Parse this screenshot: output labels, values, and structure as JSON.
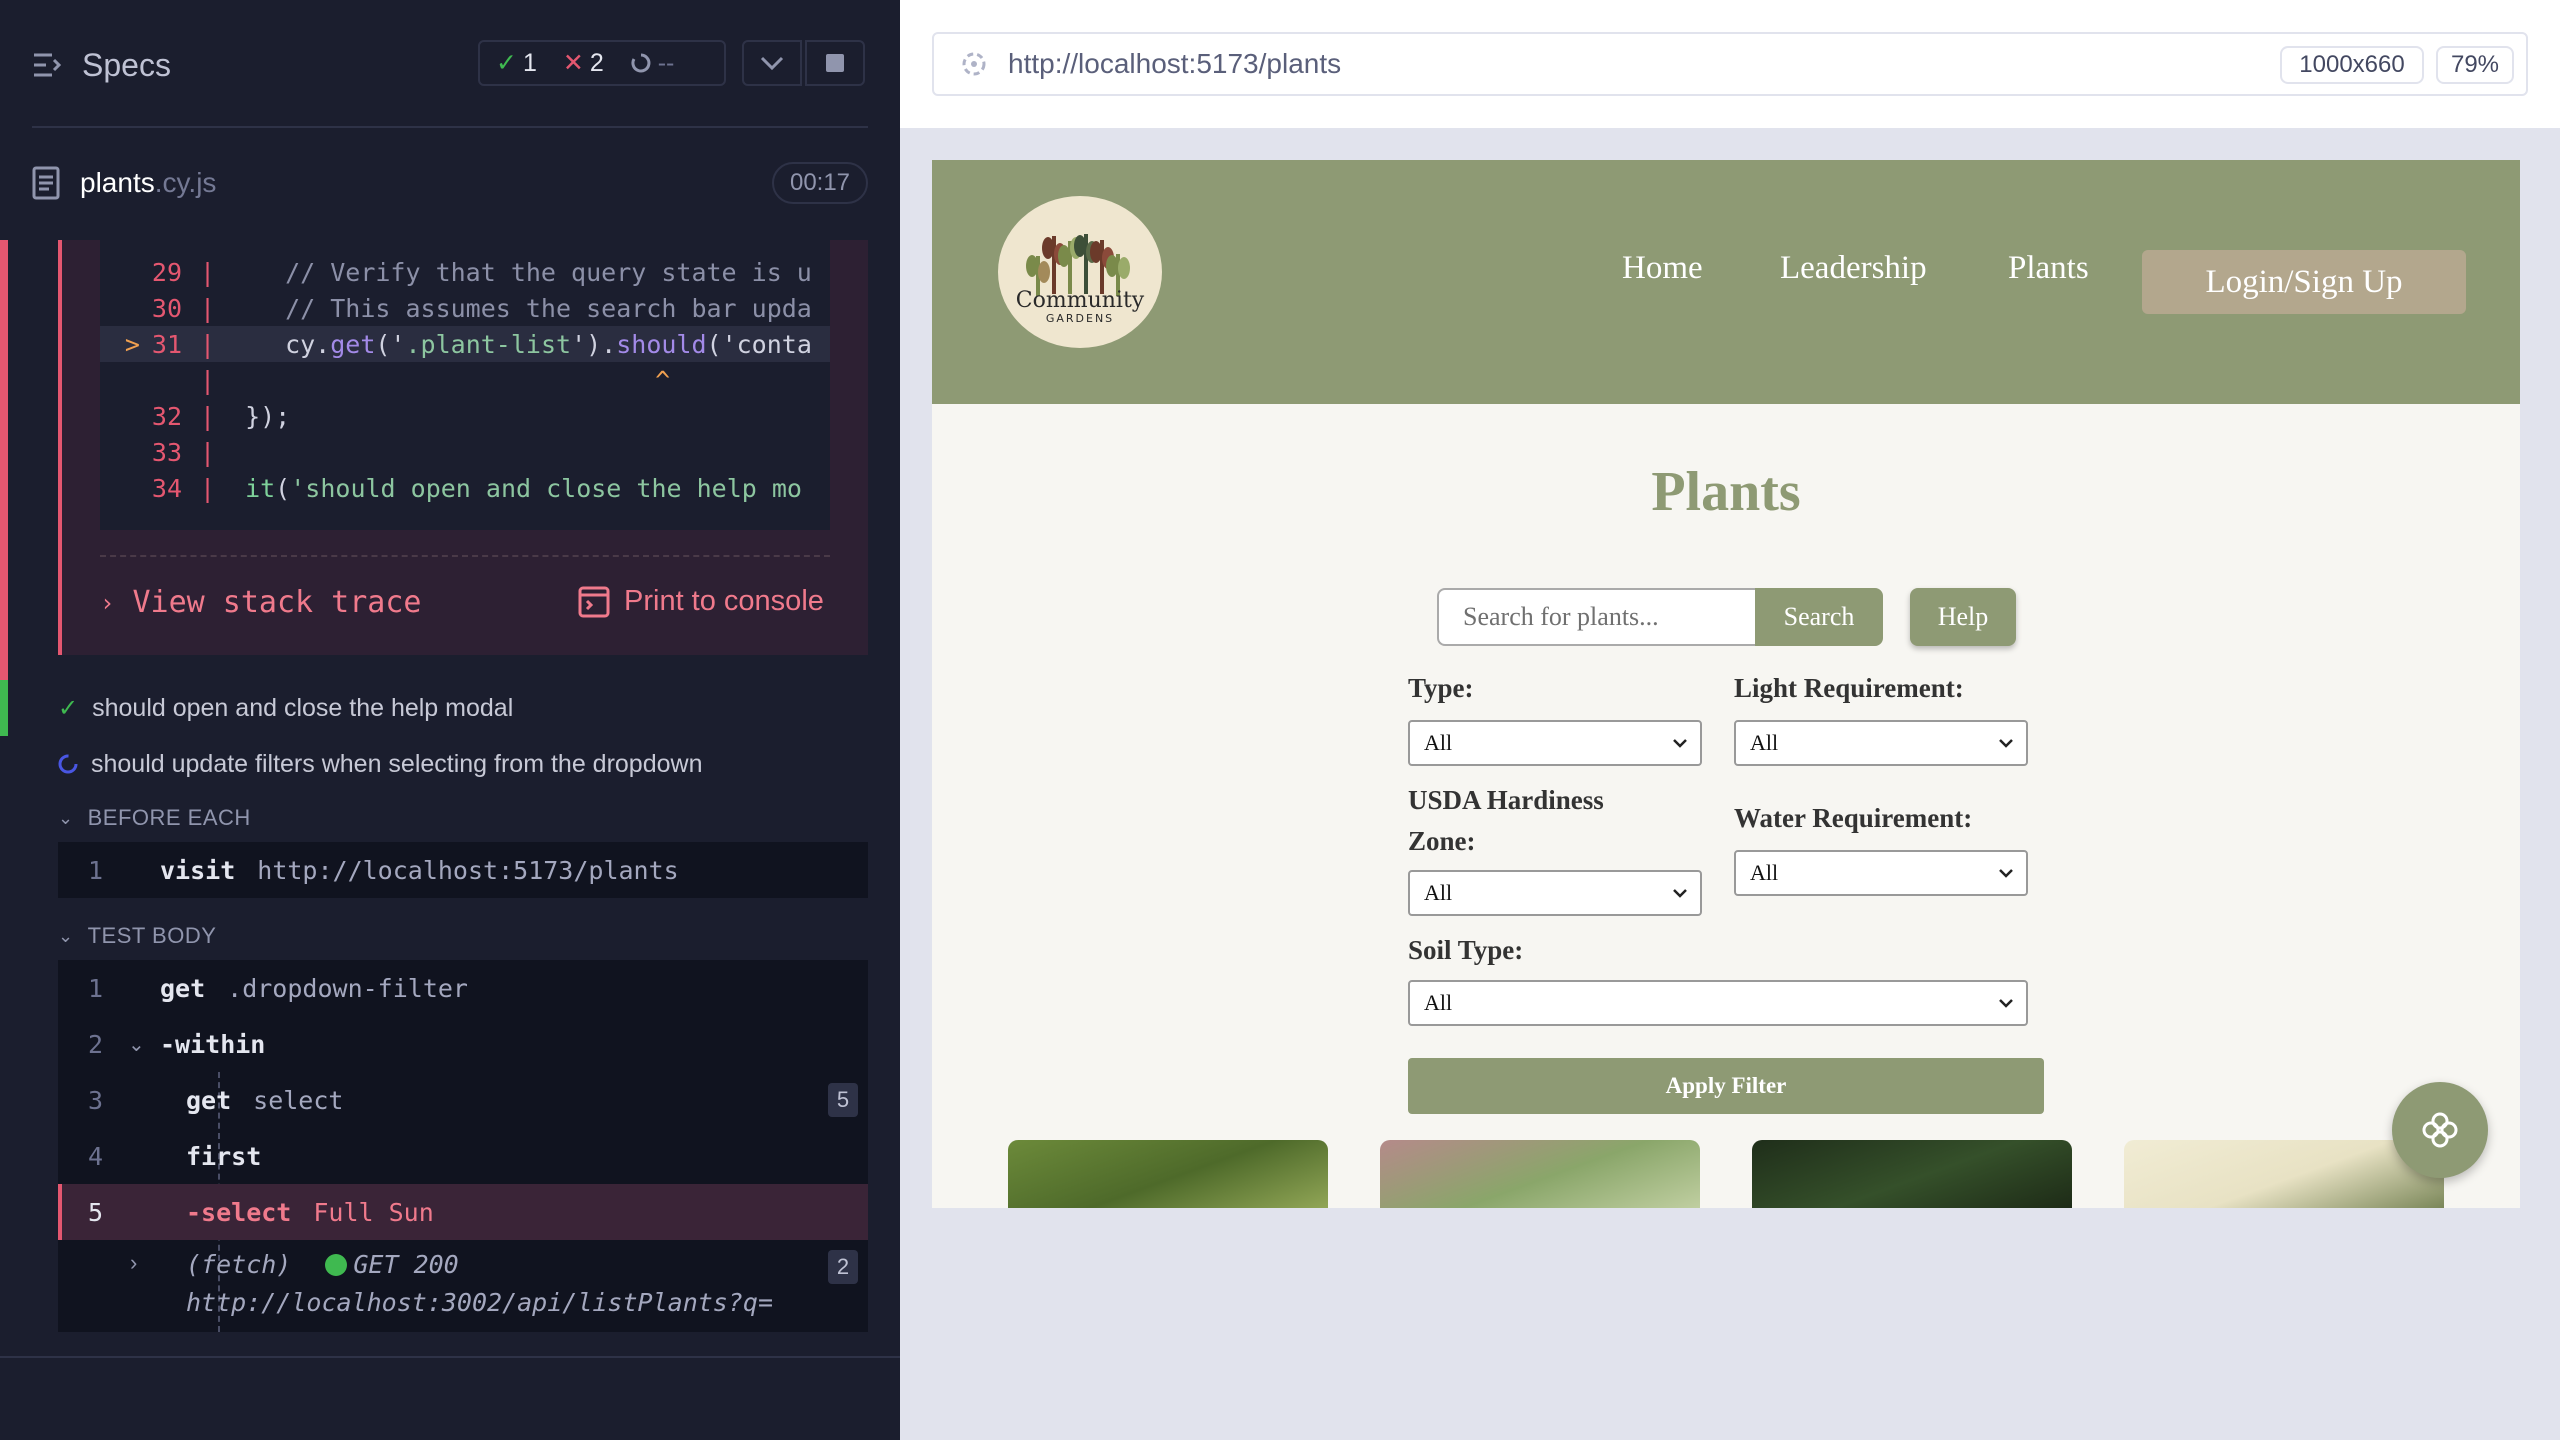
{
  "runner": {
    "specs_title": "Specs",
    "passed": "1",
    "failed": "2",
    "pending": "--",
    "file_name": "plants",
    "file_ext": ".cy.js",
    "timer": "00:17"
  },
  "code_frame": {
    "lines": [
      {
        "num": "29",
        "text": "// Verify that the query state is u"
      },
      {
        "num": "30",
        "text": "// This assumes the search bar upda"
      },
      {
        "num": "31",
        "pointer": ">",
        "pre": "cy.",
        "fn": "get",
        "s1": "('",
        "str": ".plant-list",
        "s2": "').",
        "fn2": "should",
        "s3": "('conta"
      },
      {
        "caret": "^"
      },
      {
        "num": "32",
        "text": "});"
      },
      {
        "num": "33",
        "text": ""
      },
      {
        "num": "34",
        "kw": "it",
        "s1": "(",
        "str": "'should open and close the help mo"
      }
    ],
    "view_stack_trace": "View stack trace",
    "print_to_console": "Print to console"
  },
  "tests": [
    {
      "label": "should open and close the help modal",
      "state": "passed"
    },
    {
      "label": "should update filters when selecting from the dropdown",
      "state": "running"
    }
  ],
  "before_each": {
    "title": "BEFORE EACH",
    "commands": [
      {
        "n": "1",
        "name": "visit",
        "arg": "http://localhost:5173/plants"
      }
    ]
  },
  "test_body": {
    "title": "TEST BODY",
    "commands": [
      {
        "n": "1",
        "name": "get",
        "arg": ".dropdown-filter"
      },
      {
        "n": "2",
        "name": "-within",
        "arg": ""
      },
      {
        "n": "3",
        "name": "get",
        "arg": "select",
        "badge": "5"
      },
      {
        "n": "4",
        "name": "first",
        "arg": ""
      },
      {
        "n": "5",
        "name": "-select",
        "arg": "Full Sun"
      }
    ],
    "fetch": {
      "label": "(fetch)",
      "status": "GET 200",
      "url": "http://localhost:3002/api/listPlants?q=",
      "badge": "2"
    }
  },
  "browser": {
    "url": "http://localhost:5173/plants",
    "viewport": "1000x660",
    "zoom": "79%"
  },
  "app": {
    "logo_text": "Community",
    "logo_sub": "GARDENS",
    "nav": [
      "Home",
      "Leadership",
      "Plants"
    ],
    "login": "Login/Sign Up",
    "title": "Plants",
    "search_placeholder": "Search for plants...",
    "search_btn": "Search",
    "help_btn": "Help",
    "filters": {
      "type_label": "Type:",
      "type_value": "All",
      "light_label": "Light Requirement:",
      "light_value": "All",
      "zone_label": "USDA Hardiness Zone:",
      "zone_value": "All",
      "water_label": "Water Requirement:",
      "water_value": "All",
      "soil_label": "Soil Type:",
      "soil_value": "All"
    },
    "apply_btn": "Apply Filter"
  },
  "colors": {
    "runner_bg": "#1b1e2e",
    "fail": "#e45770",
    "pass": "#3fb950",
    "app_green": "#8e9a74",
    "app_tan": "#b3a78d"
  }
}
